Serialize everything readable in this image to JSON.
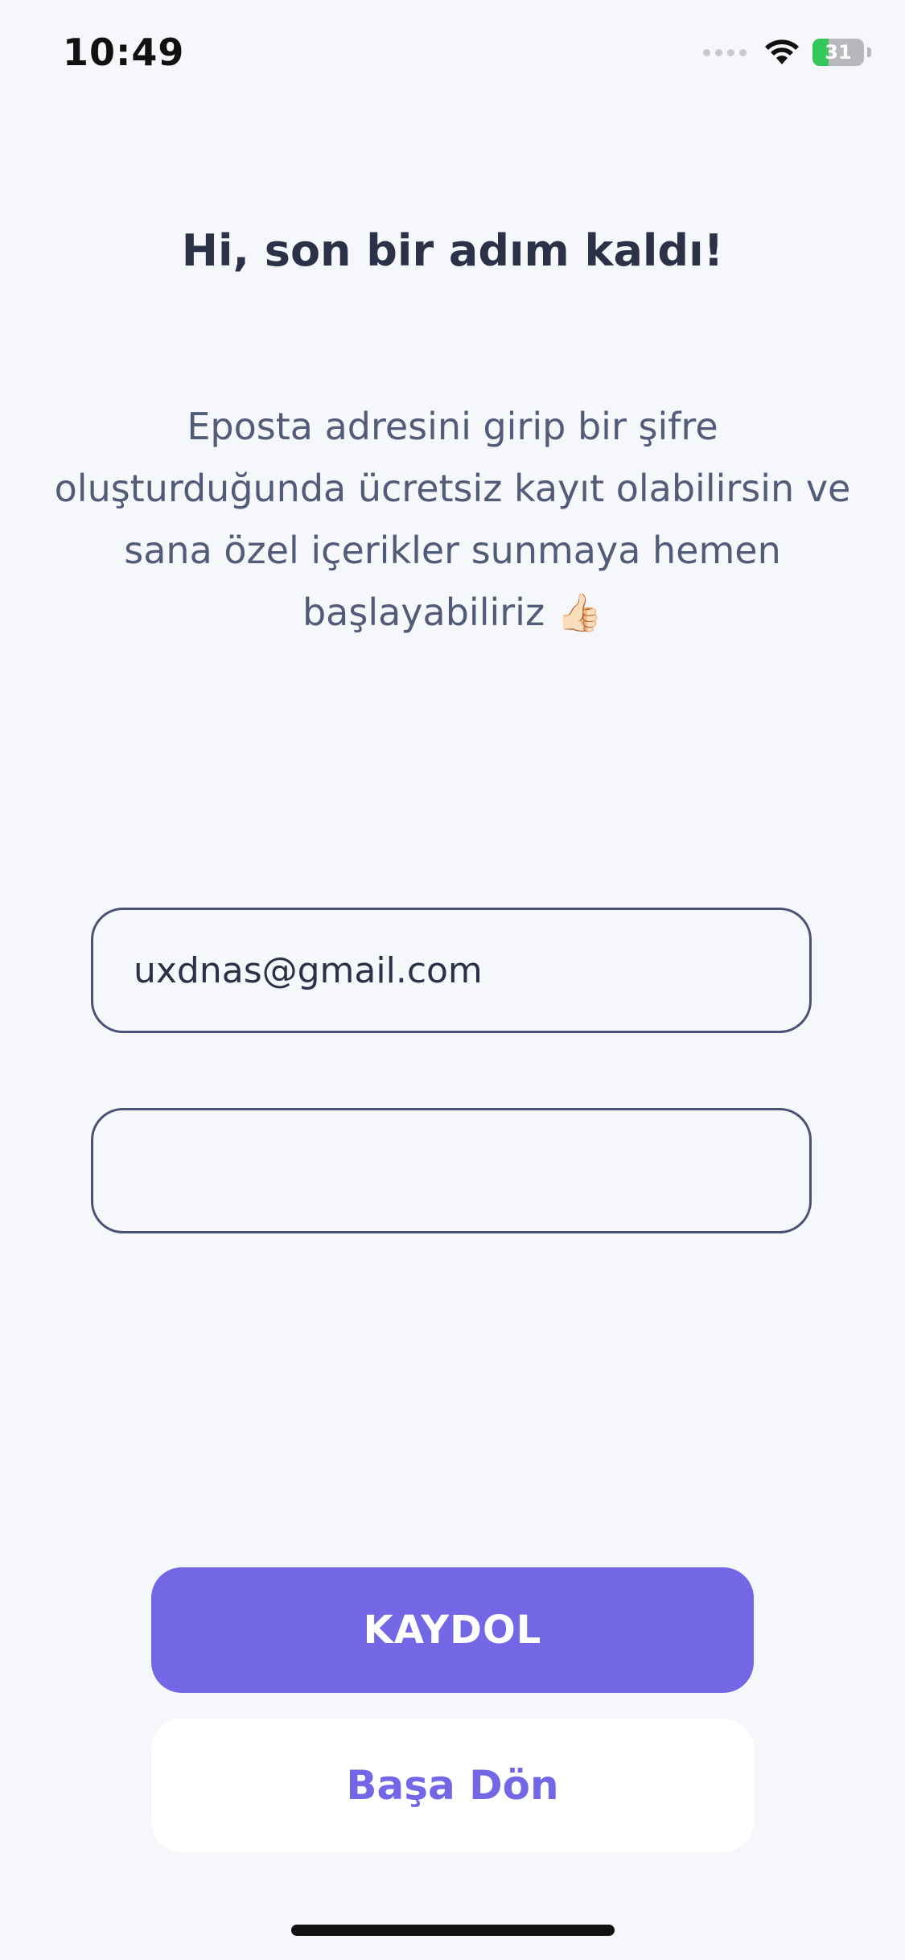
{
  "status_bar": {
    "time": "10:49",
    "battery_level": "31",
    "signal_icon": "signal-dots-icon",
    "wifi_icon": "wifi-icon",
    "battery_icon": "battery-charging-icon"
  },
  "header": {
    "title": "Hi, son bir adım kaldı!"
  },
  "description": {
    "text": "Eposta adresini girip bir şifre oluşturduğunda ücretsiz kayıt olabilirsin ve sana özel içerikler sunmaya hemen başlayabiliriz 👍🏻"
  },
  "form": {
    "email_value": "uxdnas@gmail.com",
    "password_value": ""
  },
  "buttons": {
    "primary_label": "KAYDOL",
    "secondary_label": "Başa Dön"
  },
  "colors": {
    "accent": "#7367e6",
    "background": "#f5f7fb",
    "battery_green": "#34c759"
  }
}
